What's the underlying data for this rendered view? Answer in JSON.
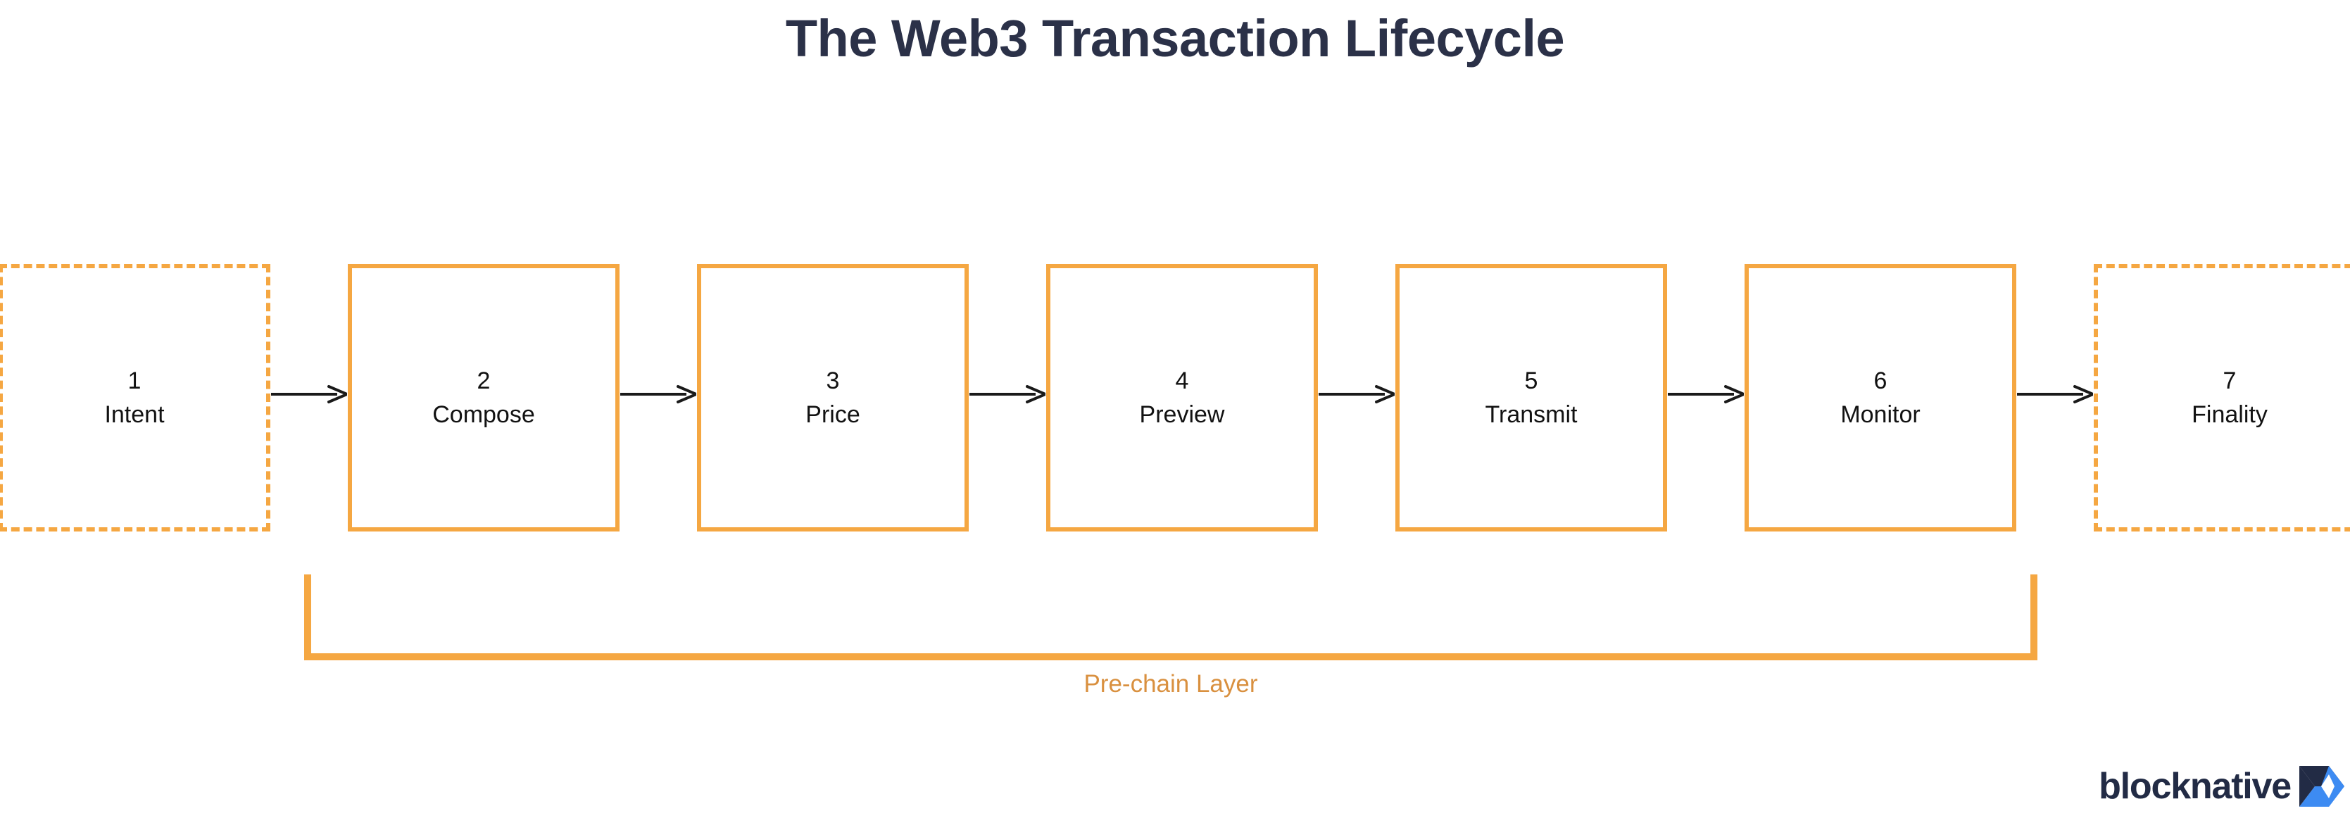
{
  "page": {
    "title": "The Web3 Transaction Lifecycle",
    "background_color": "#ffffff"
  },
  "colors": {
    "accent_orange": "#f5a742",
    "label_orange": "#d9903f",
    "title_navy": "#2b3148",
    "box_text": "#121212",
    "arrow": "#1a1a1a",
    "logo_navy": "#222b45",
    "logo_blue": "#3d8bf2"
  },
  "flow": {
    "stages": [
      {
        "number": "1",
        "label": "Intent",
        "border_style": "dashed"
      },
      {
        "number": "2",
        "label": "Compose",
        "border_style": "solid"
      },
      {
        "number": "3",
        "label": "Price",
        "border_style": "solid"
      },
      {
        "number": "4",
        "label": "Preview",
        "border_style": "solid"
      },
      {
        "number": "5",
        "label": "Transmit",
        "border_style": "solid"
      },
      {
        "number": "6",
        "label": "Monitor",
        "border_style": "solid"
      },
      {
        "number": "7",
        "label": "Finality",
        "border_style": "dashed"
      }
    ],
    "arrow_count": 6,
    "bracket": {
      "label": "Pre-chain Layer",
      "spans_stages": [
        "2",
        "3",
        "4",
        "5",
        "6"
      ]
    }
  },
  "branding": {
    "wordmark": "blocknative",
    "mark_name": "blocknative-chevron-logo"
  }
}
